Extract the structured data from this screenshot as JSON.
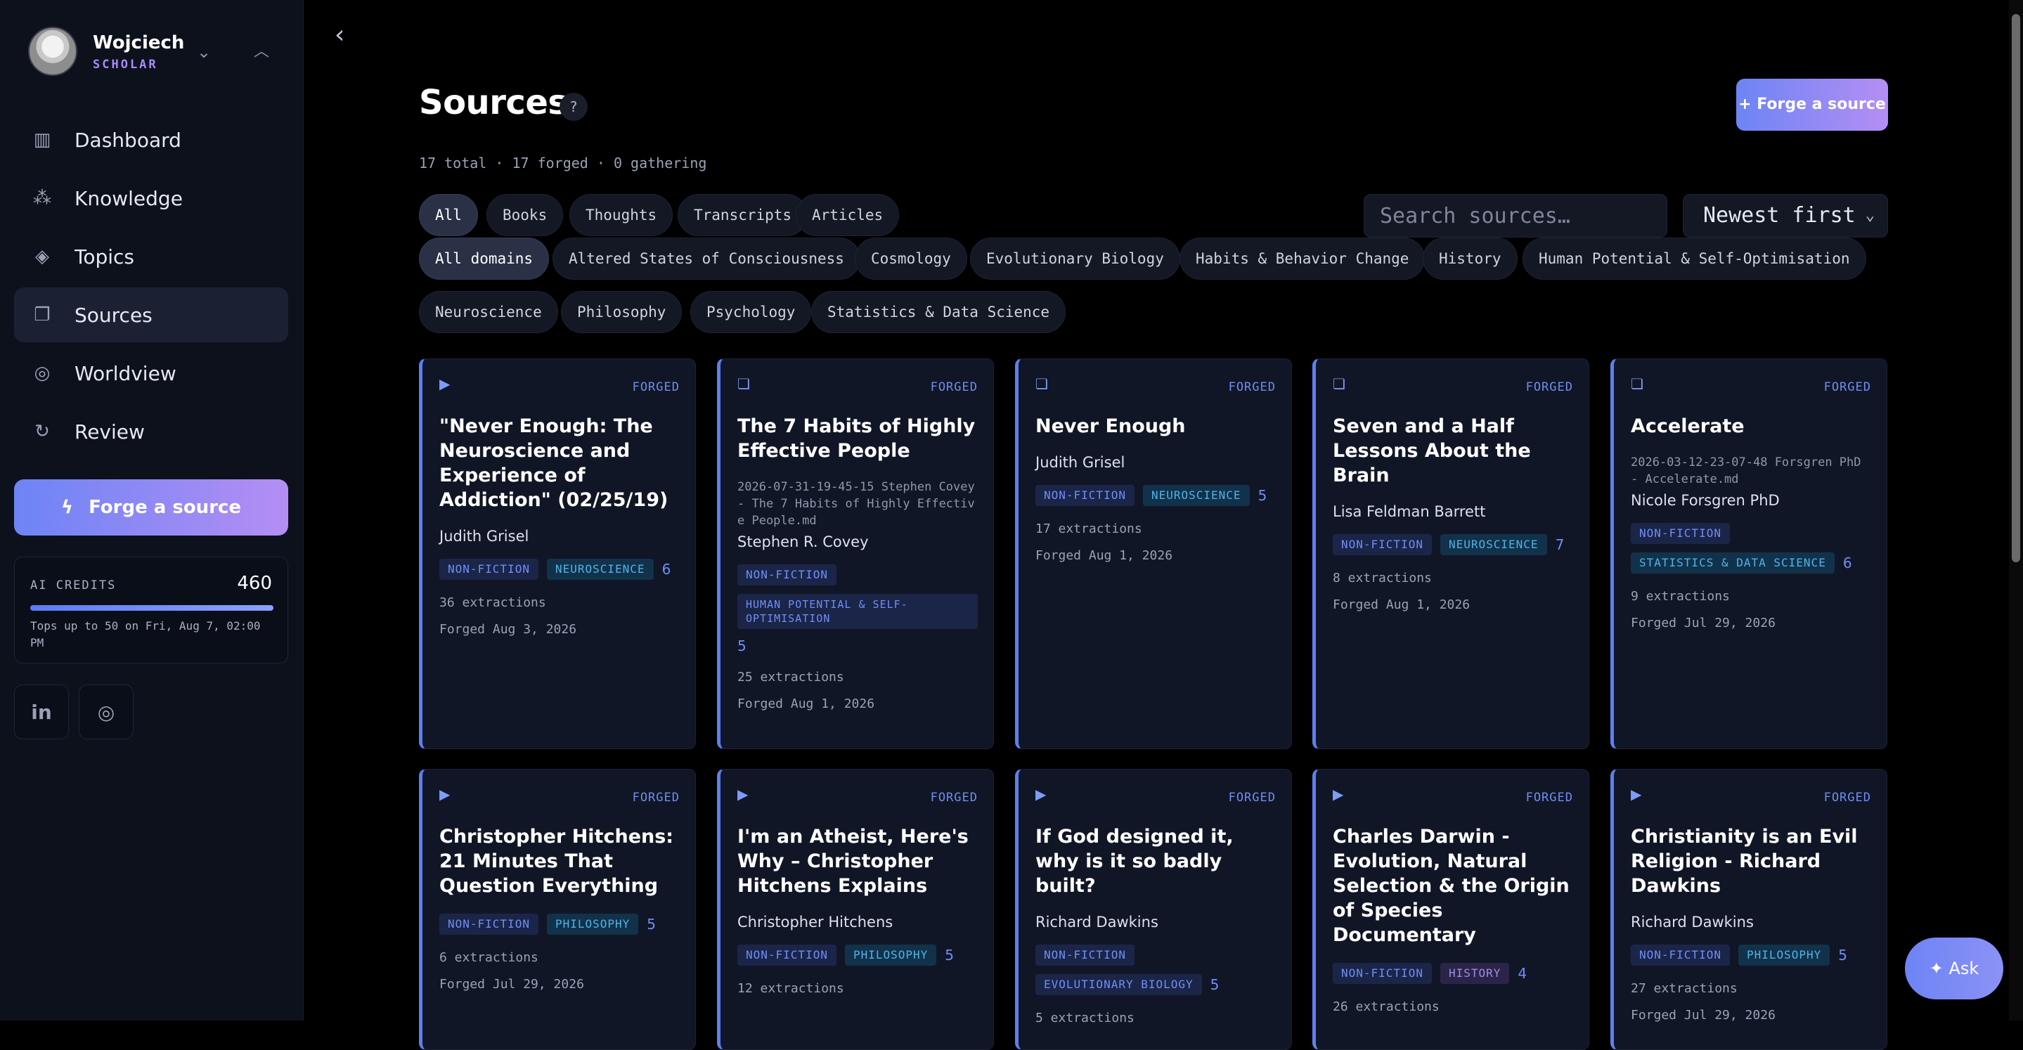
{
  "user": {
    "name": "Wojciech",
    "role": "SCHOLAR"
  },
  "nav": [
    {
      "label": "Dashboard",
      "icon": "dashboard-icon",
      "glyph": "▥"
    },
    {
      "label": "Knowledge",
      "icon": "knowledge-graph-icon",
      "glyph": "⁂"
    },
    {
      "label": "Topics",
      "icon": "layers-icon",
      "glyph": "◈"
    },
    {
      "label": "Sources",
      "icon": "sources-icon",
      "glyph": "❐",
      "active": true
    },
    {
      "label": "Worldview",
      "icon": "worldview-icon",
      "glyph": "◎"
    },
    {
      "label": "Review",
      "icon": "review-refresh-icon",
      "glyph": "↻"
    }
  ],
  "sidebar_forge_label": "Forge a source",
  "credits": {
    "label": "AI CREDITS",
    "value": "460",
    "fill_percent": 100,
    "note": "Tops up to 50 on Fri, Aug 7, 02:00 PM"
  },
  "social": {
    "linkedin": "in",
    "instagram": "◎"
  },
  "page": {
    "title": "Sources",
    "help": "?",
    "forge_label": "+ Forge a source",
    "summary": "17 total · 17 forged · 0 gathering",
    "search_placeholder": "Search sources…",
    "sort_value": "Newest first"
  },
  "type_filters": [
    "All",
    "Books",
    "Thoughts",
    "Transcripts",
    "Articles"
  ],
  "domain_filters": [
    "All domains",
    "Altered States of Consciousness",
    "Cosmology",
    "Evolutionary Biology",
    "Habits & Behavior Change",
    "History",
    "Human Potential & Self-Optimisation",
    "Neuroscience",
    "Philosophy",
    "Psychology",
    "Statistics & Data Science"
  ],
  "cards": [
    {
      "type": "video",
      "status": "FORGED",
      "title": "\"Never Enough: The Neuroscience and Experience of Addiction\" (02/25/19)",
      "file": "",
      "author": "Judith Grisel",
      "tags": [
        {
          "t": "NON-FICTION",
          "k": "nf"
        },
        {
          "t": "NEUROSCIENCE",
          "k": "topic"
        }
      ],
      "count": "6",
      "extractions": "36 extractions",
      "forged": "Forged Aug 3, 2026"
    },
    {
      "type": "book",
      "status": "FORGED",
      "title": "The 7 Habits of Highly Effective People",
      "file": "2026-07-31-19-45-15 Stephen Covey - The 7 Habits of Highly Effective People.md",
      "author": "Stephen R. Covey",
      "tags": [
        {
          "t": "NON-FICTION",
          "k": "nf"
        },
        {
          "t": "HUMAN POTENTIAL & SELF-OPTIMISATION",
          "k": "nf",
          "wide": true
        }
      ],
      "count": "5",
      "extractions": "25 extractions",
      "forged": "Forged Aug 1, 2026"
    },
    {
      "type": "book",
      "status": "FORGED",
      "title": "Never Enough",
      "file": "",
      "author": "Judith Grisel",
      "tags": [
        {
          "t": "NON-FICTION",
          "k": "nf"
        },
        {
          "t": "NEUROSCIENCE",
          "k": "topic"
        }
      ],
      "count": "5",
      "extractions": "17 extractions",
      "forged": "Forged Aug 1, 2026"
    },
    {
      "type": "book",
      "status": "FORGED",
      "title": "Seven and a Half Lessons About the Brain",
      "file": "",
      "author": "Lisa Feldman Barrett",
      "tags": [
        {
          "t": "NON-FICTION",
          "k": "nf"
        },
        {
          "t": "NEUROSCIENCE",
          "k": "topic"
        }
      ],
      "count": "7",
      "extractions": "8 extractions",
      "forged": "Forged Aug 1, 2026"
    },
    {
      "type": "book",
      "status": "FORGED",
      "title": "Accelerate",
      "file": "2026-03-12-23-07-48 Forsgren PhD - Accelerate.md",
      "author": "Nicole Forsgren PhD",
      "tags": [
        {
          "t": "NON-FICTION",
          "k": "nf"
        },
        {
          "t": "STATISTICS & DATA SCIENCE",
          "k": "topic"
        }
      ],
      "count": "6",
      "extractions": "9 extractions",
      "forged": "Forged Jul 29, 2026"
    },
    {
      "type": "video",
      "status": "FORGED",
      "title": "Christopher Hitchens: 21 Minutes That Question Everything",
      "file": "",
      "author": "",
      "tags": [
        {
          "t": "NON-FICTION",
          "k": "nf"
        },
        {
          "t": "PHILOSOPHY",
          "k": "topic"
        }
      ],
      "count": "5",
      "extractions": "6 extractions",
      "forged": "Forged Jul 29, 2026"
    },
    {
      "type": "video",
      "status": "FORGED",
      "title": "I'm an Atheist, Here's Why – Christopher Hitchens Explains",
      "file": "",
      "author": "Christopher Hitchens",
      "tags": [
        {
          "t": "NON-FICTION",
          "k": "nf"
        },
        {
          "t": "PHILOSOPHY",
          "k": "topic"
        }
      ],
      "count": "5",
      "extractions": "12 extractions",
      "forged": ""
    },
    {
      "type": "video",
      "status": "FORGED",
      "title": "If God designed it, why is it so badly built?",
      "file": "",
      "author": "Richard Dawkins",
      "tags": [
        {
          "t": "NON-FICTION",
          "k": "nf"
        },
        {
          "t": "EVOLUTIONARY BIOLOGY",
          "k": "nf"
        }
      ],
      "count": "5",
      "extractions": "5 extractions",
      "forged": ""
    },
    {
      "type": "video",
      "status": "FORGED",
      "title": "Charles Darwin - Evolution, Natural Selection & the Origin of Species Documentary",
      "file": "",
      "author": "",
      "tags": [
        {
          "t": "NON-FICTION",
          "k": "nf"
        },
        {
          "t": "HISTORY",
          "k": "purple"
        }
      ],
      "count": "4",
      "extractions": "26 extractions",
      "forged": ""
    },
    {
      "type": "video",
      "status": "FORGED",
      "title": "Christianity is an Evil Religion - Richard Dawkins",
      "file": "",
      "author": "Richard Dawkins",
      "tags": [
        {
          "t": "NON-FICTION",
          "k": "nf"
        },
        {
          "t": "PHILOSOPHY",
          "k": "topic"
        }
      ],
      "count": "5",
      "extractions": "27 extractions",
      "forged": "Forged Jul 29, 2026"
    }
  ],
  "ask_label": "Ask"
}
